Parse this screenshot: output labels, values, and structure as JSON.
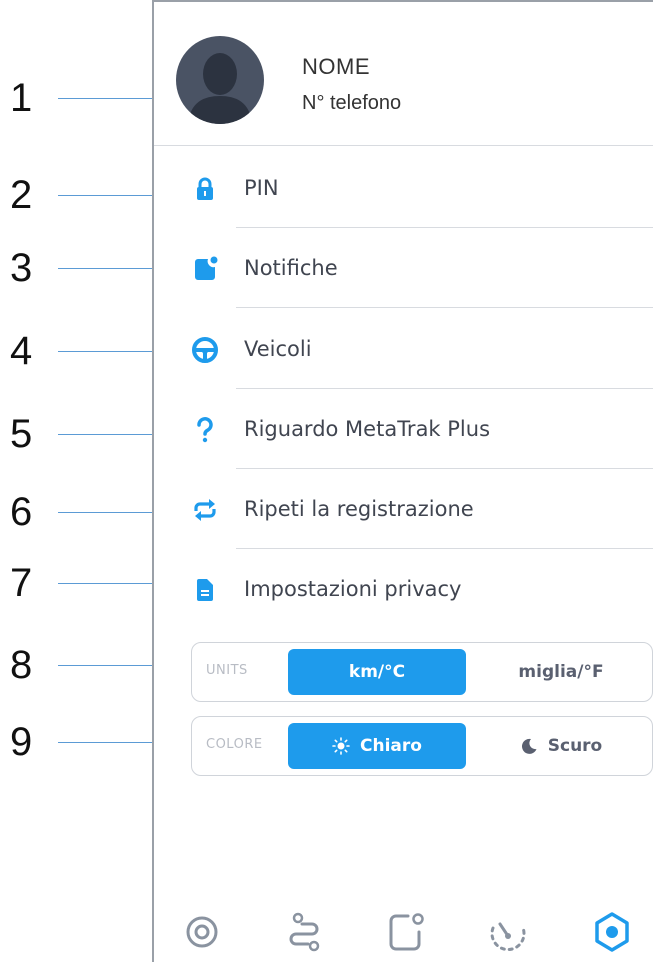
{
  "callouts": [
    "1",
    "2",
    "3",
    "4",
    "5",
    "6",
    "7",
    "8",
    "9"
  ],
  "profile": {
    "name": "NOME",
    "phone": "N° telefono"
  },
  "menu": [
    {
      "label": "PIN",
      "icon": "lock-icon"
    },
    {
      "label": "Notifiche",
      "icon": "notification-icon"
    },
    {
      "label": "Veicoli",
      "icon": "steering-wheel-icon"
    },
    {
      "label": "Riguardo MetaTrak Plus",
      "icon": "question-icon"
    },
    {
      "label": "Ripeti la registrazione",
      "icon": "repeat-icon"
    },
    {
      "label": "Impostazioni privacy",
      "icon": "document-icon"
    }
  ],
  "units": {
    "label": "UNITS",
    "active": "km/°C",
    "inactive": "miglia/°F"
  },
  "color_mode": {
    "label": "COLORE",
    "active": "Chiaro",
    "inactive": "Scuro"
  },
  "tabbar": [
    "target-icon",
    "route-icon",
    "square-dot-icon",
    "speedometer-icon",
    "settings-hex-icon"
  ],
  "colors": {
    "accent": "#1e9bec",
    "callout_line": "#5b9bd5",
    "inactive_tab": "#8a93a0"
  }
}
